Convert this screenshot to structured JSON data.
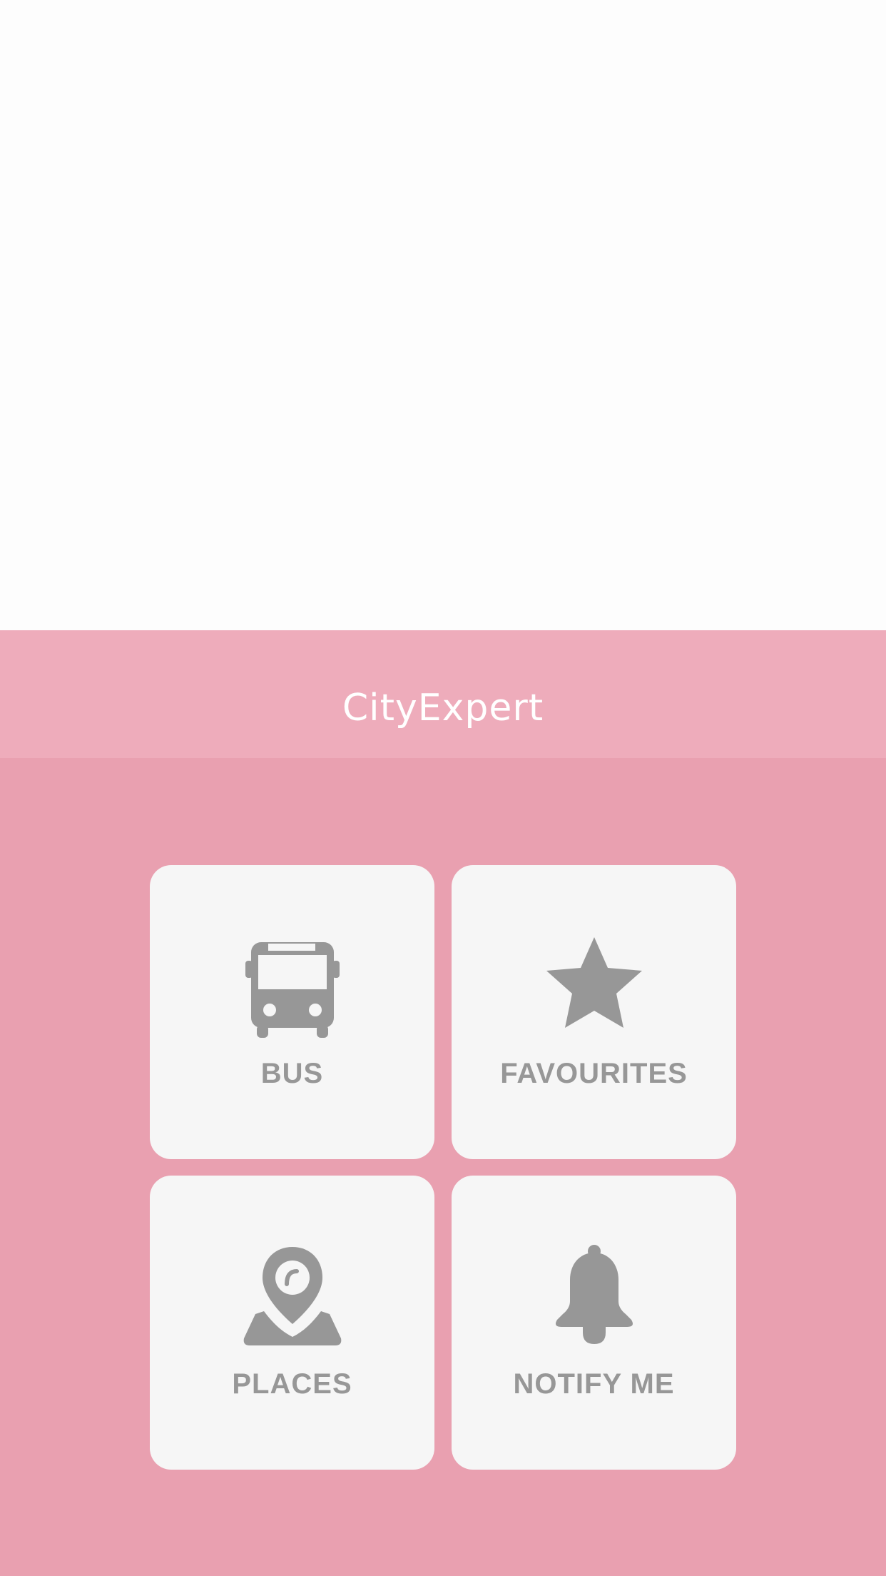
{
  "app": {
    "title": "CityExpert"
  },
  "theme": {
    "header_bg": "#eeacbb",
    "body_bg": "#e9a0b0",
    "tile_bg": "#f6f6f6",
    "icon_color": "#979797"
  },
  "menu": {
    "bus": {
      "label": "BUS",
      "icon": "bus-icon"
    },
    "favourites": {
      "label": "FAVOURITES",
      "icon": "star-icon"
    },
    "places": {
      "label": "PLACES",
      "icon": "map-pin-icon"
    },
    "notify": {
      "label": "NOTIFY ME",
      "icon": "bell-icon"
    }
  }
}
